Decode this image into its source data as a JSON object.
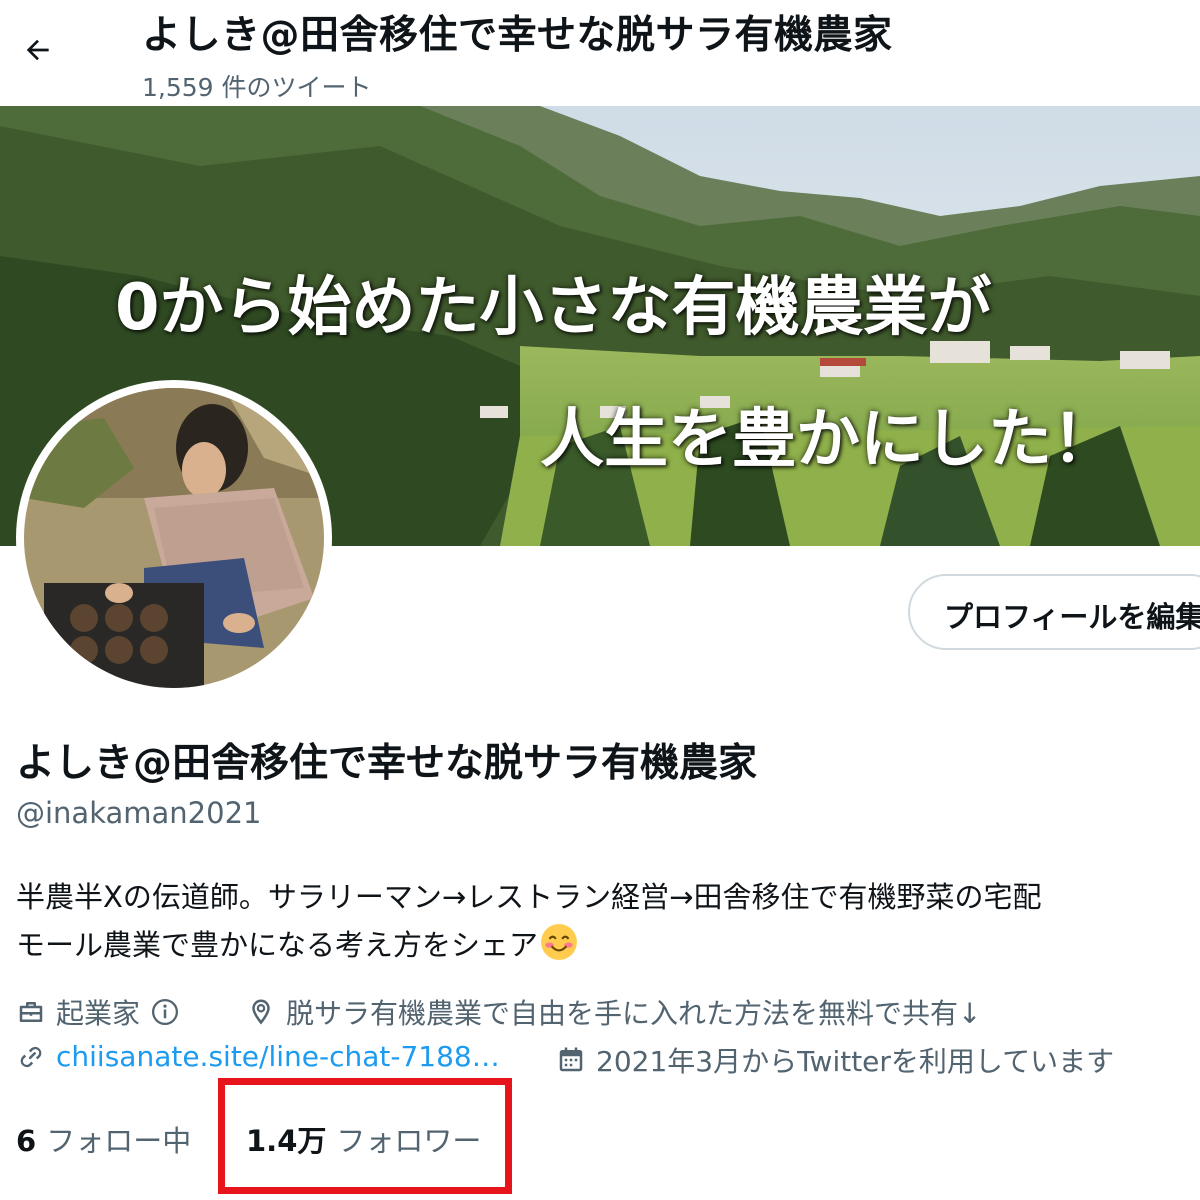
{
  "header": {
    "title": "よしき@田舎移住で幸せな脱サラ有機農家",
    "tweet_count": "1,559 件のツイート"
  },
  "banner": {
    "line1": "0から始めた小さな有機農業が",
    "line2": "人生を豊かにした！"
  },
  "profile": {
    "edit_button_label": "プロフィールを編集",
    "display_name": "よしき@田舎移住で幸せな脱サラ有機農家",
    "handle": "@inakaman2021",
    "bio_line1": "半農半Xの伝道師。サラリーマン→レストラン経営→田舎移住で有機野菜の宅配",
    "bio_line2": "モール農業で豊かになる考え方をシェア",
    "bio_emoji": "smiling-face-emoji",
    "category": "起業家",
    "location": "脱サラ有機農業で自由を手に入れた方法を無料で共有↓",
    "url": "chiisanate.site/line-chat-7188…",
    "joined": "2021年3月からTwitterを利用しています"
  },
  "stats": {
    "following_count": "6",
    "following_label": "フォロー中",
    "followers_count": "1.4万",
    "followers_label": "フォロワー"
  },
  "colors": {
    "text": "#0f1419",
    "secondary": "#536471",
    "link": "#1d9bf0",
    "highlight": "#e8141c"
  }
}
